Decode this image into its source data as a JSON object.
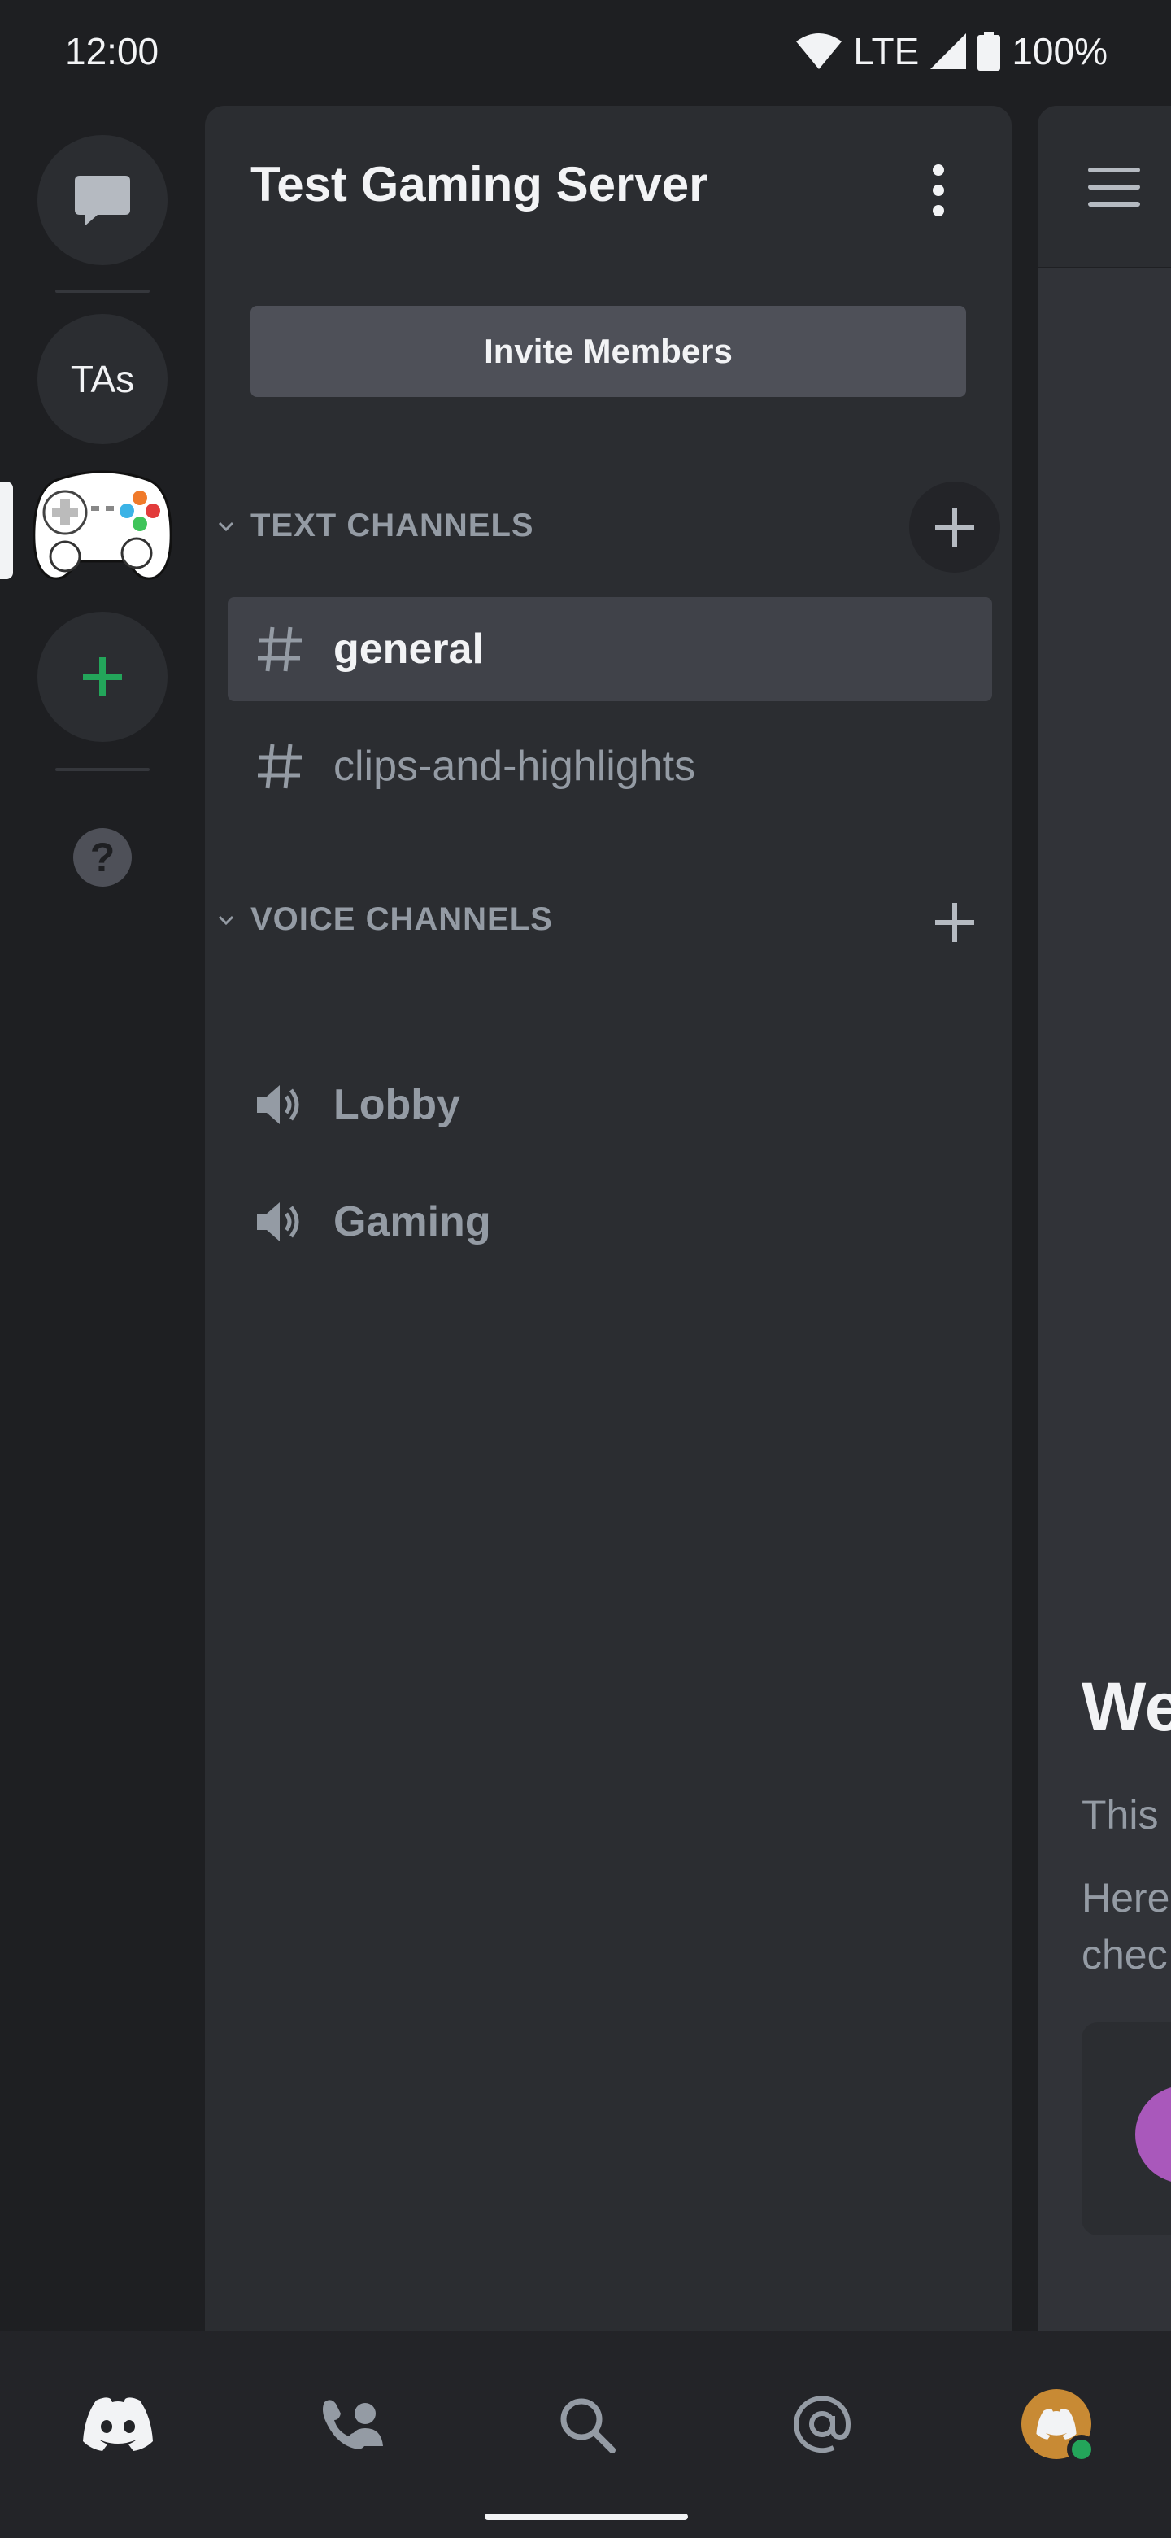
{
  "status_bar": {
    "time": "12:00",
    "network": "LTE",
    "battery": "100%"
  },
  "server": {
    "name": "Test Gaming Server",
    "invite_label": "Invite Members"
  },
  "rail": {
    "tas_label": "TAs",
    "help_glyph": "?"
  },
  "categories": [
    {
      "label": "TEXT CHANNELS"
    },
    {
      "label": "VOICE CHANNELS"
    }
  ],
  "text_channels": [
    {
      "name": "general",
      "selected": true
    },
    {
      "name": "clips-and-highlights",
      "selected": false
    }
  ],
  "voice_channels": [
    {
      "name": "Lobby"
    },
    {
      "name": "Gaming"
    }
  ],
  "peek": {
    "welcome": "We",
    "line1": "This",
    "line2": "Here",
    "line3": "chec"
  },
  "icons": {
    "dm": "chat-bubble-icon",
    "add_server": "plus-icon",
    "help": "question-icon",
    "text_channel": "hash-icon",
    "voice_channel": "speaker-icon",
    "nav": [
      "discord-home-icon",
      "friends-icon",
      "search-icon",
      "mention-icon",
      "avatar"
    ]
  },
  "colors": {
    "accent_green": "#23a55a",
    "avatar_orange": "#c88a34",
    "background": "#1e1f22",
    "panel": "#2b2d31"
  }
}
